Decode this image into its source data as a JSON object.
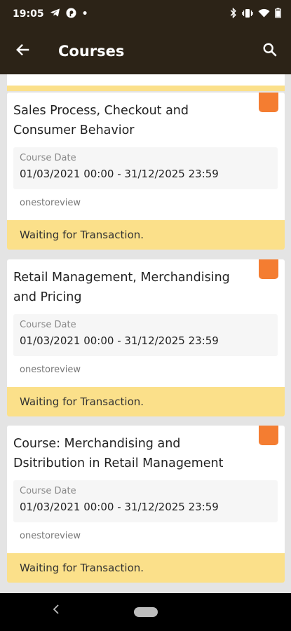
{
  "status_bar": {
    "time": "19:05",
    "dot": "•",
    "left_icons": [
      "telegram-icon",
      "pinterest-icon"
    ],
    "right_icons": [
      "bluetooth-icon",
      "vibrate-icon",
      "wifi-icon",
      "battery-icon"
    ]
  },
  "app_bar": {
    "title": "Courses",
    "back_icon": "arrow-left-icon",
    "search_icon": "search-icon"
  },
  "courses": [
    {
      "title": "Sales Process, Checkout and Consumer Behavior",
      "date_label": "Course Date",
      "date_range": "01/03/2021 00:00 - 31/12/2025 23:59",
      "provider": "onestoreview",
      "status": "Waiting for Transaction."
    },
    {
      "title": "Retail Management, Merchandising and Pricing",
      "date_label": "Course Date",
      "date_range": "01/03/2021 00:00 - 31/12/2025 23:59",
      "provider": "onestoreview",
      "status": "Waiting for Transaction."
    },
    {
      "title": "Course: Merchandising and Dsitribution in Retail Management",
      "date_label": "Course Date",
      "date_range": "01/03/2021 00:00 - 31/12/2025 23:59",
      "provider": "onestoreview",
      "status": "Waiting for Transaction."
    }
  ],
  "colors": {
    "app_bar": "#2c2317",
    "badge": "#f47d31",
    "status_strip": "#fbe08a",
    "background": "#e4e4e4"
  },
  "nav_bar": {
    "back_icon": "chevron-left-icon",
    "home_icon": "home-pill-icon"
  }
}
